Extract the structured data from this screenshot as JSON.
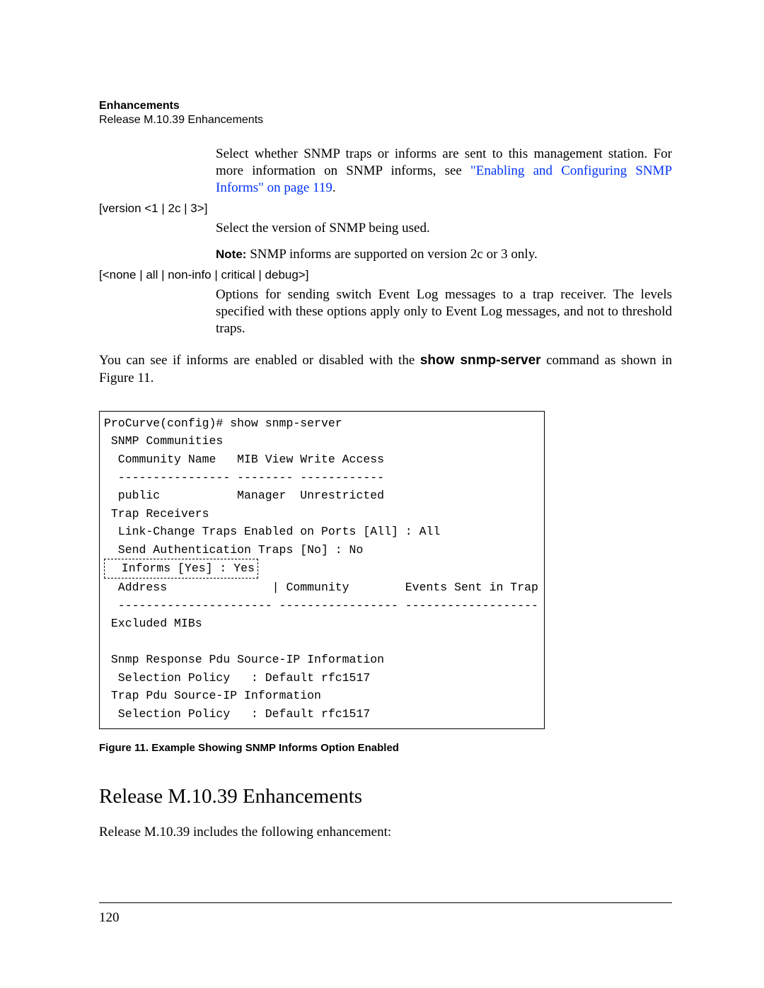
{
  "header": {
    "title": "Enhancements",
    "subtitle": "Release M.10.39 Enhancements"
  },
  "para_traps": "Select whether SNMP traps or informs are sent to this management station. For more information on SNMP informs, see ",
  "link_text": "\"Enabling and Configuring SNMP Informs\" on page 119",
  "period": ".",
  "syntax_version": "[version <1 | 2c | 3>]",
  "para_version": "Select the version of SNMP being used.",
  "note_label": "Note:",
  "note_body": " SNMP informs are supported on version 2c or 3 only.",
  "syntax_options": "[<none | all | non-info | critical | debug>]",
  "para_options": "Options for sending switch Event Log messages to a trap receiver. The levels specified with these options apply only to Event Log messages, and not to threshold traps.",
  "para_show_pre": "You can see if informs are enabled or disabled with the ",
  "para_show_bold": "show snmp-server",
  "para_show_post": " command as shown in Figure 11.",
  "code": {
    "l1": "ProCurve(config)# show snmp-server",
    "l2": " SNMP Communities",
    "l3": "  Community Name   MIB View Write Access",
    "l4": "  ---------------- -------- ------------",
    "l5": "  public           Manager  Unrestricted",
    "l6": " Trap Receivers",
    "l7": "  Link-Change Traps Enabled on Ports [All] : All",
    "l8": "  Send Authentication Traps [No] : No",
    "l9": "  Informs [Yes] : Yes",
    "l10": "  Address               | Community        Events Sent in Trap",
    "l11": "  ---------------------- ----------------- -------------------",
    "l12": " Excluded MIBs",
    "l13": " Snmp Response Pdu Source-IP Information",
    "l14": "  Selection Policy   : Default rfc1517",
    "l15": " Trap Pdu Source-IP Information",
    "l16": "  Selection Policy   : Default rfc1517"
  },
  "figure_caption": "Figure 11.  Example Showing SNMP Informs Option Enabled",
  "section_heading": "Release M.10.39 Enhancements",
  "section_body": "Release M.10.39 includes the following enhancement:",
  "page_number": "120"
}
